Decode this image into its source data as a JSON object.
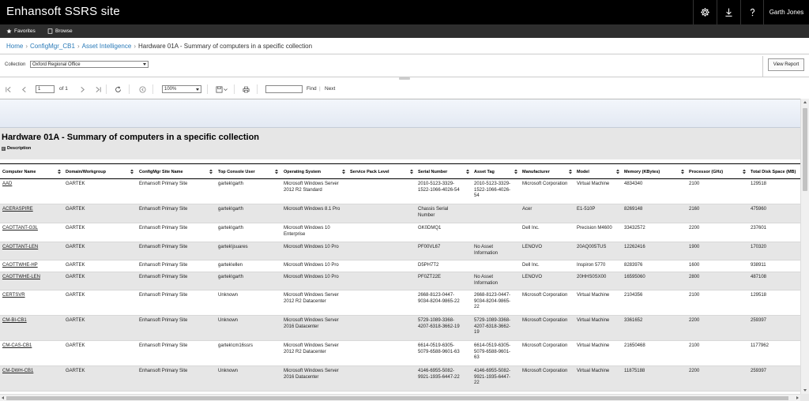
{
  "header": {
    "title": "Enhansoft SSRS site",
    "user": "Garth Jones",
    "icons": [
      "gear-icon",
      "download-icon",
      "help-icon"
    ]
  },
  "favbar": {
    "favorites_label": "Favorites",
    "browse_label": "Browse"
  },
  "breadcrumb": {
    "items": [
      "Home",
      "ConfigMgr_CB1",
      "Asset Intelligence"
    ],
    "current": "Hardware 01A - Summary of computers in a specific collection"
  },
  "parameters": {
    "collection_label": "Collection",
    "collection_value": "Oxford Regional Office",
    "view_report_label": "View Report"
  },
  "toolbar": {
    "page_value": "1",
    "page_of": "of  1",
    "zoom_value": "100%",
    "find_label": "Find",
    "separator": "|",
    "next_label": "Next"
  },
  "report": {
    "title": "Hardware 01A - Summary of computers in a specific collection",
    "description_label": "Description",
    "columns": [
      "Computer Name",
      "Domain/Workgroup",
      "ConfigMgr Site Name",
      "Top Console User",
      "Operating System",
      "Service Pack Level",
      "Serial Number",
      "Asset Tag",
      "Manufacturer",
      "Model",
      "Memory (KBytes)",
      "Processor (GHz)",
      "Total Disk Space (MB)"
    ],
    "rows": [
      [
        "AAD",
        "GARTEK",
        "Enhansoft Primary Site",
        "gartek\\garth",
        "Microsoft Windows Server 2012 R2 Standard",
        "",
        "2010-5123-3329-1522-1066-4026-54",
        "2010-5123-3329-1522-1066-4026-54",
        "Microsoft Corporation",
        "Virtual Machine",
        "4834340",
        "2100",
        "129518"
      ],
      [
        "ACERASPIRE",
        "GARTEK",
        "Enhansoft Primary Site",
        "gartek\\garth",
        "Microsoft Windows 8.1 Pro",
        "",
        "Chassis Serial Number",
        "",
        "Acer",
        "E1-510P",
        "8269148",
        "2160",
        "475960"
      ],
      [
        "CAOTTANT-G3L",
        "GARTEK",
        "Enhansoft Primary Site",
        "gartek\\garth",
        "Microsoft Windows 10 Enterprise",
        "",
        "GK0DMQ1",
        "",
        "Dell Inc.",
        "Precision M4600",
        "33432572",
        "2200",
        "237601"
      ],
      [
        "CAOTTANT-LEN",
        "GARTEK",
        "Enhansoft Primary Site",
        "gartek\\jsuares",
        "Microsoft Windows 10 Pro",
        "",
        "PF00VL67",
        "No Asset Information",
        "LENOVO",
        "20AQ005TUS",
        "12262416",
        "1900",
        "170320"
      ],
      [
        "CAOTTWHE-HP",
        "GARTEK",
        "Enhansoft Primary Site",
        "gartek\\ellen",
        "Microsoft Windows 10 Pro",
        "",
        "D5PH7T2",
        "",
        "Dell Inc.",
        "Inspiron 5770",
        "8283976",
        "1600",
        "938911"
      ],
      [
        "CAOTTWHE-LEN",
        "GARTEK",
        "Enhansoft Primary Site",
        "gartek\\garth",
        "Microsoft Windows 10 Pro",
        "",
        "PF0ZT22E",
        "No Asset Information",
        "LENOVO",
        "20HHS0SX00",
        "16595060",
        "2800",
        "487108"
      ],
      [
        "CERTSVR",
        "GARTEK",
        "Enhansoft Primary Site",
        "Unknown",
        "Microsoft Windows Server 2012 R2 Datacenter",
        "",
        "2668-8123-0447-9034-8204-9865-22",
        "2668-8123-0447-9034-8204-9865-22",
        "Microsoft Corporation",
        "Virtual Machine",
        "2104356",
        "2100",
        "129518"
      ],
      [
        "CM-BI-CB1",
        "GARTEK",
        "Enhansoft Primary Site",
        "Unknown",
        "Microsoft Windows Server 2016 Datacenter",
        "",
        "5729-1089-3368-4207-6318-3662-19",
        "5729-1089-3368-4207-6318-3662-19",
        "Microsoft Corporation",
        "Virtual Machine",
        "3361652",
        "2200",
        "259397"
      ],
      [
        "CM-CAS-CB1",
        "GARTEK",
        "Enhansoft Primary Site",
        "gartek\\cm16ssrs",
        "Microsoft Windows Server 2012 R2 Datacenter",
        "",
        "6614-0519-6305-5079-6588-9601-63",
        "6614-0519-6305-5079-6588-9601-63",
        "Microsoft Corporation",
        "Virtual Machine",
        "21650468",
        "2100",
        "1177962"
      ],
      [
        "CM-DWH-CB1",
        "GARTEK",
        "Enhansoft Primary Site",
        "Unknown",
        "Microsoft Windows Server 2016 Datacenter",
        "",
        "4146-6955-5082-9921-1935-6447-22",
        "4146-6955-5082-9921-1935-6447-22",
        "Microsoft Corporation",
        "Virtual Machine",
        "11875188",
        "2200",
        "259397"
      ]
    ]
  },
  "colors": {
    "header_bg": "#000000",
    "favbar_bg": "#2e2e2e",
    "link": "#2a7ab8",
    "alt_row": "#e6e6e6",
    "banner": "#e3e9f3"
  }
}
